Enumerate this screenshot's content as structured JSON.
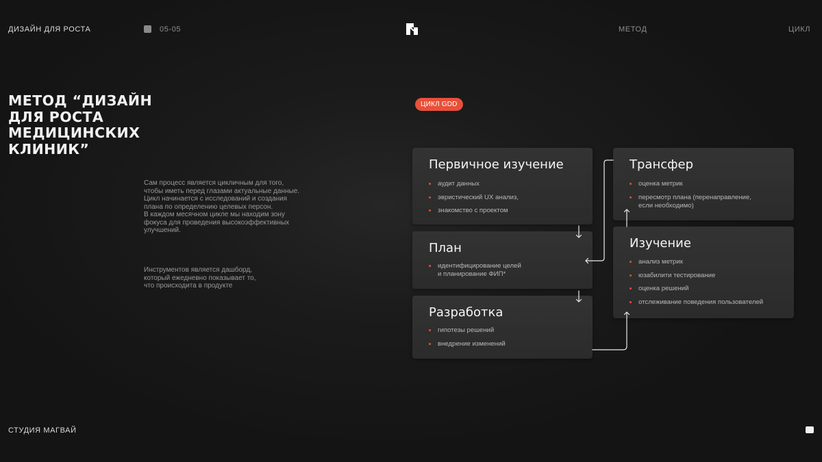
{
  "header": {
    "brand": "ДИЗАЙН ДЛЯ РОСТА",
    "page_number": "05-05",
    "nav_method": "МЕТОД",
    "nav_cycle": "ЦИКЛ"
  },
  "title": "МЕТОД “ДИЗАЙН ДЛЯ РОСТА МЕДИЦИНСКИХ КЛИНИК”",
  "description": {
    "paragraph_1": "Сам процесс является цикличным для того,\nчтобы иметь перед глазами актуальные данные.\nЦикл начинается с исследований и создания\nплана по определению целевых персон.\nВ каждом месячном цикле мы находим зону\nфокуса для проведения высокоэффективных\nулучшений.",
    "paragraph_2": "Инструментов является дашборд,\nкоторый ежедневно показывает то,\nчто происходита в продукте"
  },
  "badge": "ЦИКЛ GDD",
  "cards": [
    {
      "title": "Первичное изучение",
      "items": [
        "аудит данных",
        "эвристический UX анализ,",
        "знакомство с проектом"
      ]
    },
    {
      "title": "План",
      "items": [
        "идентифицирование целей\nи планирование ФИП*"
      ]
    },
    {
      "title": "Разработка",
      "items": [
        "гипотезы решений",
        "внедрение изменений"
      ]
    },
    {
      "title": "Трансфер",
      "items": [
        "оценка метрик",
        "пересмотр плана (перенаправление,\nесли необходимо)"
      ]
    },
    {
      "title": "Изучение",
      "items": [
        "анализ метрик",
        "юзабилити тестирование",
        "оценка решений",
        "отслеживание поведения пользователей"
      ]
    }
  ],
  "footer": {
    "studio": "СТУДИЯ МАГВАЙ"
  },
  "colors": {
    "accent": "#e8503a",
    "background": "#1b1b1b",
    "card": "#303030"
  },
  "icons": {
    "logo": "studio-logo-icon",
    "corner": "corner-square-icon"
  }
}
